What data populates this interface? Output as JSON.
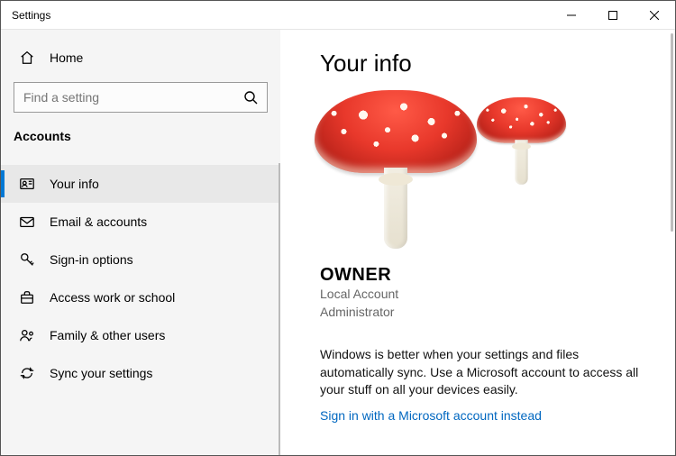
{
  "window": {
    "title": "Settings"
  },
  "sidebar": {
    "home_label": "Home",
    "search_placeholder": "Find a setting",
    "category": "Accounts",
    "items": [
      {
        "label": "Your info"
      },
      {
        "label": "Email & accounts"
      },
      {
        "label": "Sign-in options"
      },
      {
        "label": "Access work or school"
      },
      {
        "label": "Family & other users"
      },
      {
        "label": "Sync your settings"
      }
    ]
  },
  "main": {
    "title": "Your info",
    "owner_name": "OWNER",
    "account_type": "Local Account",
    "account_role": "Administrator",
    "promo_text": "Windows is better when your settings and files automatically sync. Use a Microsoft account to access all your stuff on all your devices easily.",
    "signin_link": "Sign in with a Microsoft account instead"
  }
}
